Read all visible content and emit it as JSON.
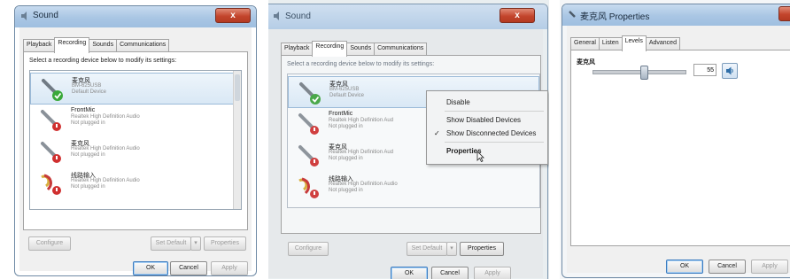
{
  "panel1": {
    "title": "Sound",
    "close": "x",
    "tabs": [
      "Playback",
      "Recording",
      "Sounds",
      "Communications"
    ],
    "active_tab": "Recording",
    "instruction": "Select a recording device below to modify its settings:",
    "devices": [
      {
        "name": "麦克风",
        "line1": "BM-625USB",
        "line2": "Default Device",
        "status": "default"
      },
      {
        "name": "FrontMic",
        "line1": "Realtek High Definition Audio",
        "line2": "Not plugged in",
        "status": "unplugged"
      },
      {
        "name": "麦克风",
        "line1": "Realtek High Definition Audio",
        "line2": "Not plugged in",
        "status": "unplugged"
      },
      {
        "name": "线路输入",
        "line1": "Realtek High Definition Audio",
        "line2": "Not plugged in",
        "status": "unplugged"
      }
    ],
    "buttons": {
      "configure": "Configure",
      "set_default": "Set Default",
      "properties": "Properties",
      "ok": "OK",
      "cancel": "Cancel",
      "apply": "Apply"
    }
  },
  "panel2": {
    "title": "Sound",
    "close": "x",
    "tabs": [
      "Playback",
      "Recording",
      "Sounds",
      "Communications"
    ],
    "active_tab": "Recording",
    "instruction": "Select a recording device below to modify its settings:",
    "devices": [
      {
        "name": "麦克风",
        "line1": "BM-625USB",
        "line2": "Default Device"
      },
      {
        "name": "FrontMic",
        "line1": "Realtek High Definition Aud",
        "line2": "Not plugged in"
      },
      {
        "name": "麦克风",
        "line1": "Realtek High Definition Aud",
        "line2": "Not plugged in"
      },
      {
        "name": "线路输入",
        "line1": "Realtek High Definition Audio",
        "line2": "Not plugged in"
      }
    ],
    "context_menu": {
      "disable": "Disable",
      "show_disabled": "Show Disabled Devices",
      "show_disconnected": "Show Disconnected Devices",
      "properties": "Properties",
      "check": "✓"
    },
    "buttons": {
      "configure": "Configure",
      "set_default": "Set Default",
      "properties": "Properties",
      "ok": "OK",
      "cancel": "Cancel",
      "apply": "Apply"
    }
  },
  "panel3": {
    "title": "麦克风 Properties",
    "close": "x",
    "tabs": [
      "General",
      "Listen",
      "Levels",
      "Advanced"
    ],
    "active_tab": "Levels",
    "level_label": "麦克风",
    "level_value": "55",
    "level_fraction": 0.55,
    "buttons": {
      "ok": "OK",
      "cancel": "Cancel",
      "apply": "Apply"
    }
  },
  "colors": {
    "accent": "#3b7bbf",
    "close": "#c3452c",
    "default_check": "#3aa83a",
    "unplugged": "#d03030"
  }
}
